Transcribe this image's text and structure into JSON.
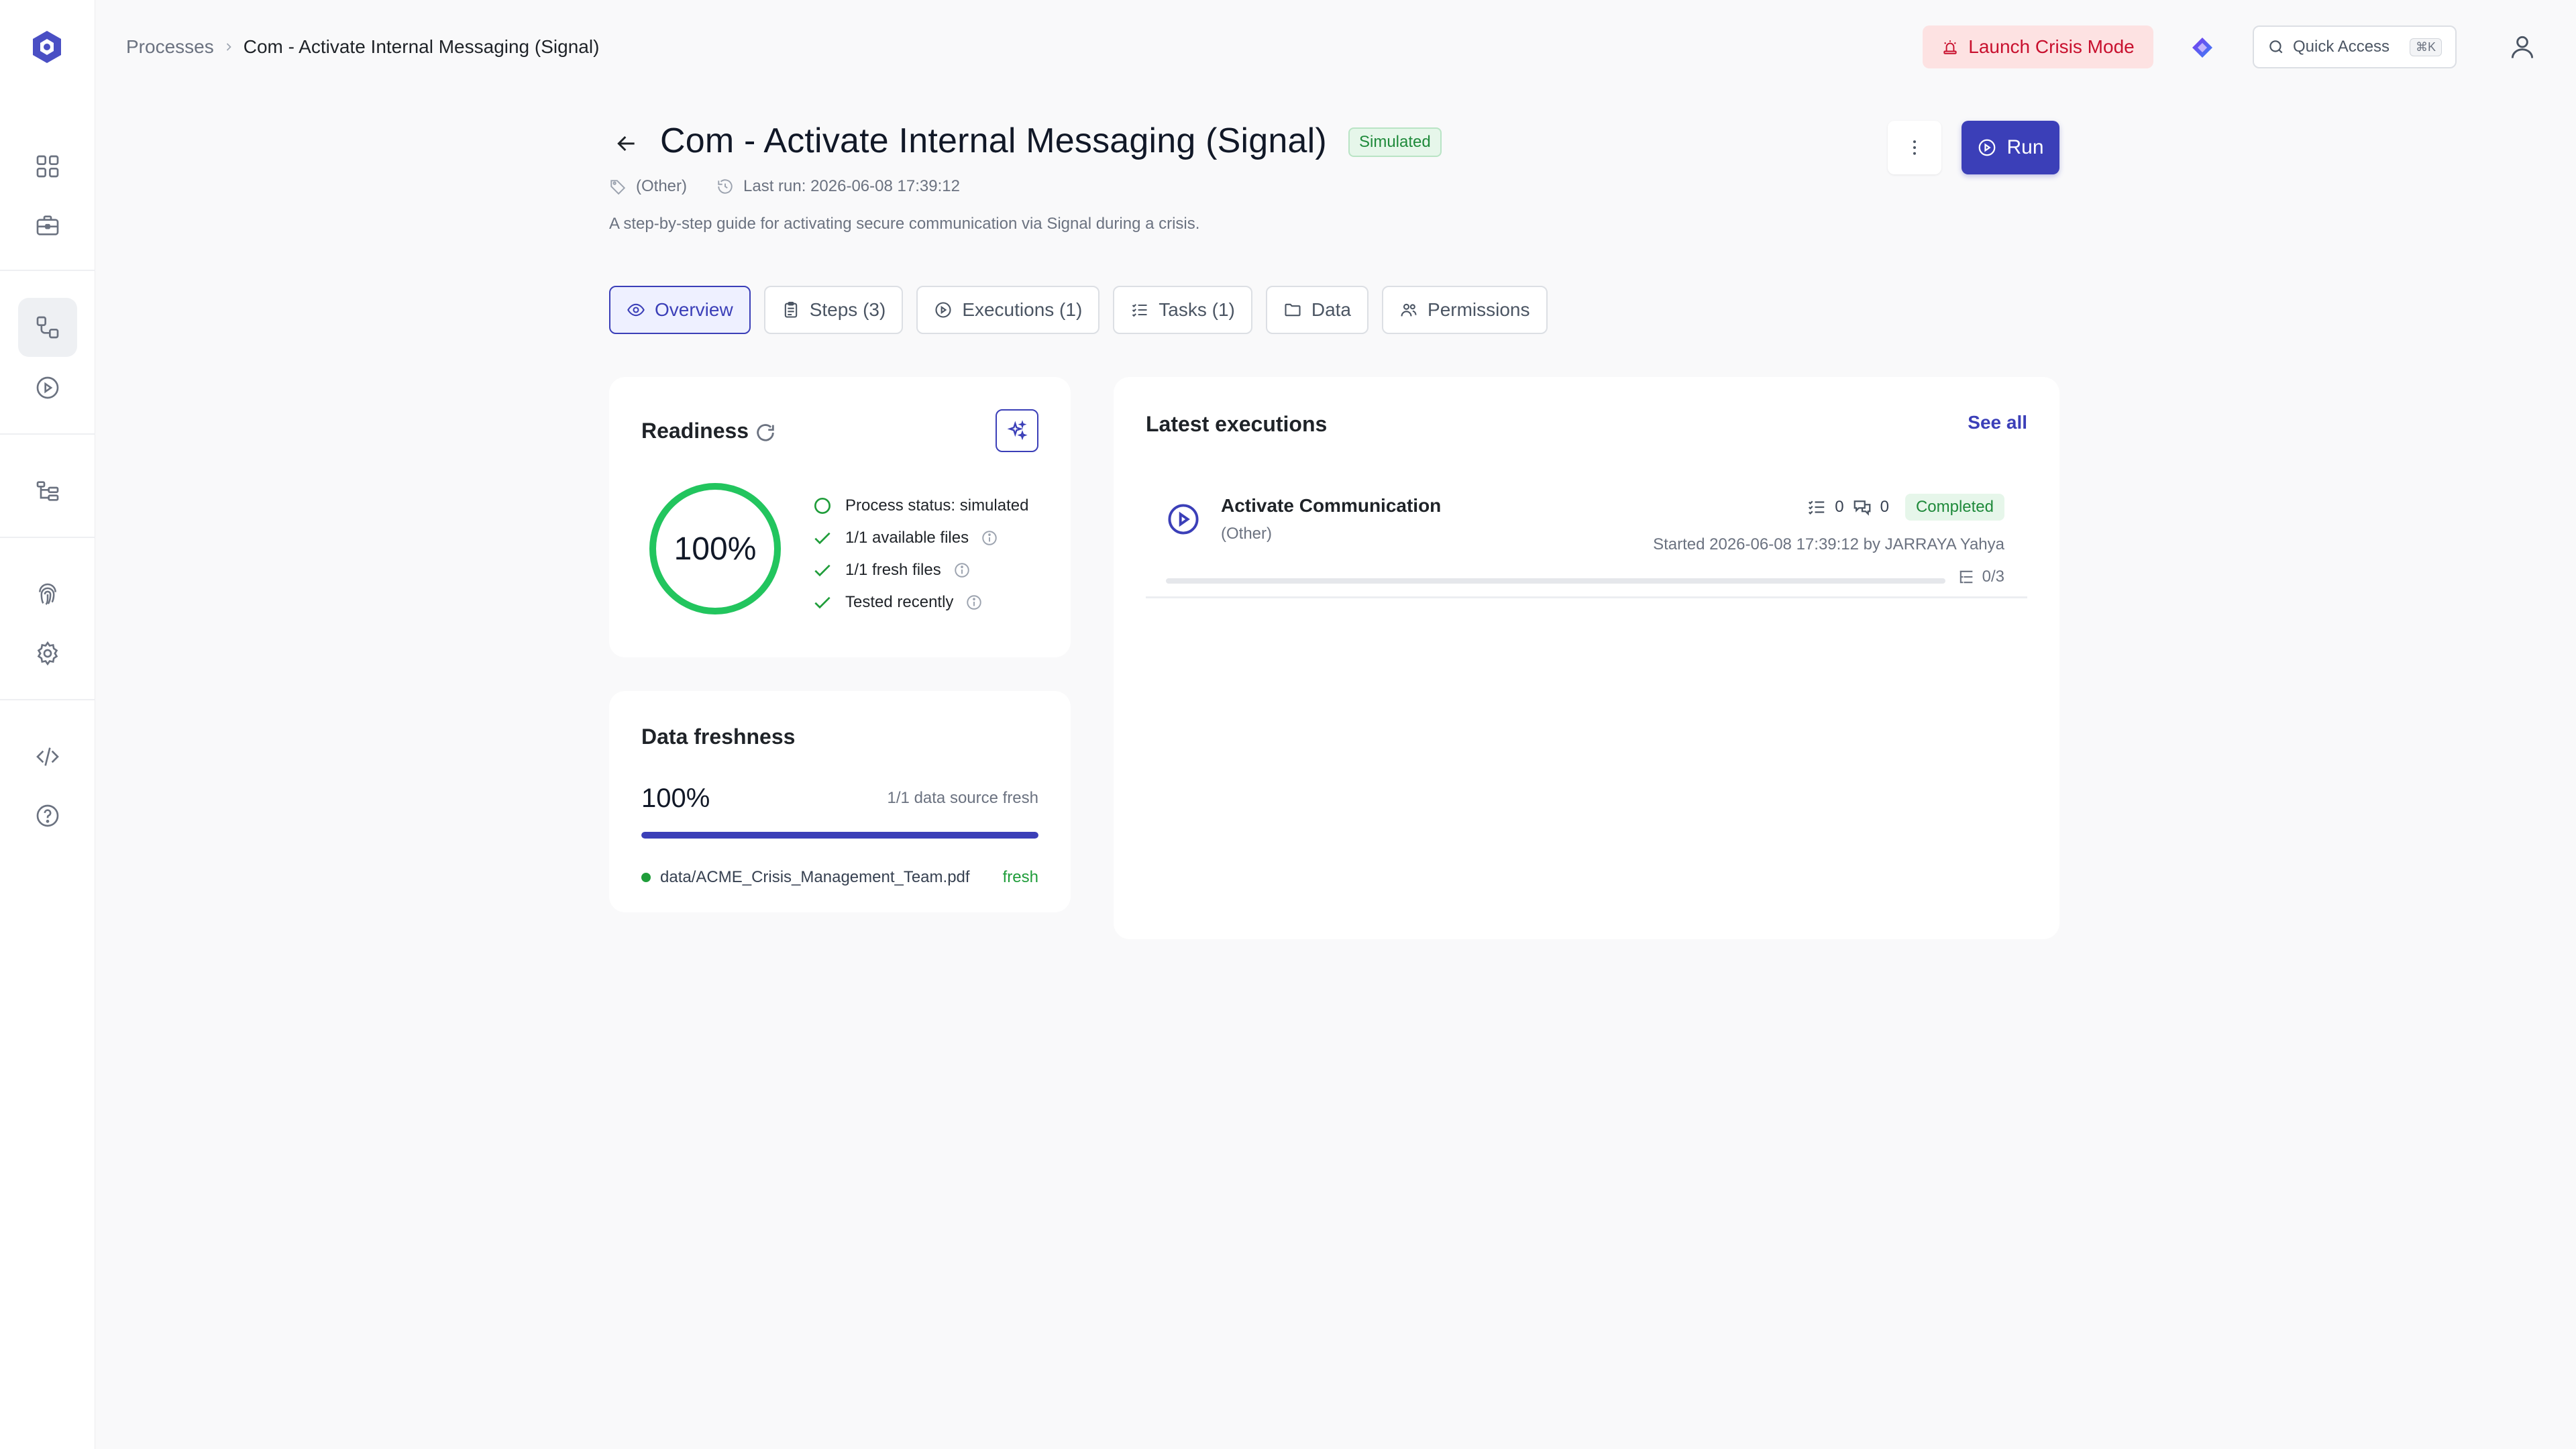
{
  "breadcrumb": {
    "root": "Processes",
    "current": "Com - Activate Internal Messaging (Signal)"
  },
  "topbar": {
    "crisis_label": "Launch Crisis Mode",
    "quick_access_label": "Quick Access",
    "quick_access_kbd": "⌘K"
  },
  "process": {
    "title": "Com - Activate Internal Messaging (Signal)",
    "status": "Simulated",
    "category": "(Other)",
    "last_run": "Last run: 2026-06-08 17:39:12",
    "description": "A step-by-step guide for activating secure communication via Signal during a crisis.",
    "run_label": "Run"
  },
  "tabs": [
    {
      "label": "Overview"
    },
    {
      "label": "Steps (3)"
    },
    {
      "label": "Executions (1)"
    },
    {
      "label": "Tasks (1)"
    },
    {
      "label": "Data"
    },
    {
      "label": "Permissions"
    }
  ],
  "readiness": {
    "title": "Readiness",
    "percent_label": "100%",
    "percent": 100,
    "checks": [
      {
        "label": "Process status: simulated"
      },
      {
        "label": "1/1 available files"
      },
      {
        "label": "1/1 fresh files"
      },
      {
        "label": "Tested recently"
      }
    ]
  },
  "freshness": {
    "title": "Data freshness",
    "percent_label": "100%",
    "percent": 100,
    "count_label": "1/1 data source fresh",
    "file": "data/ACME_Crisis_Management_Team.pdf",
    "file_status": "fresh"
  },
  "executions": {
    "title": "Latest executions",
    "see_all": "See all",
    "items": [
      {
        "name": "Activate Communication",
        "category": "(Other)",
        "tasks_count": "0",
        "comments_count": "0",
        "status": "Completed",
        "started": "Started 2026-06-08 17:39:12 by JARRAYA Yahya",
        "steps_progress": "0/3"
      }
    ]
  },
  "colors": {
    "accent": "#3b3fb8",
    "success": "#1f9d3a",
    "danger": "#c8102e"
  }
}
